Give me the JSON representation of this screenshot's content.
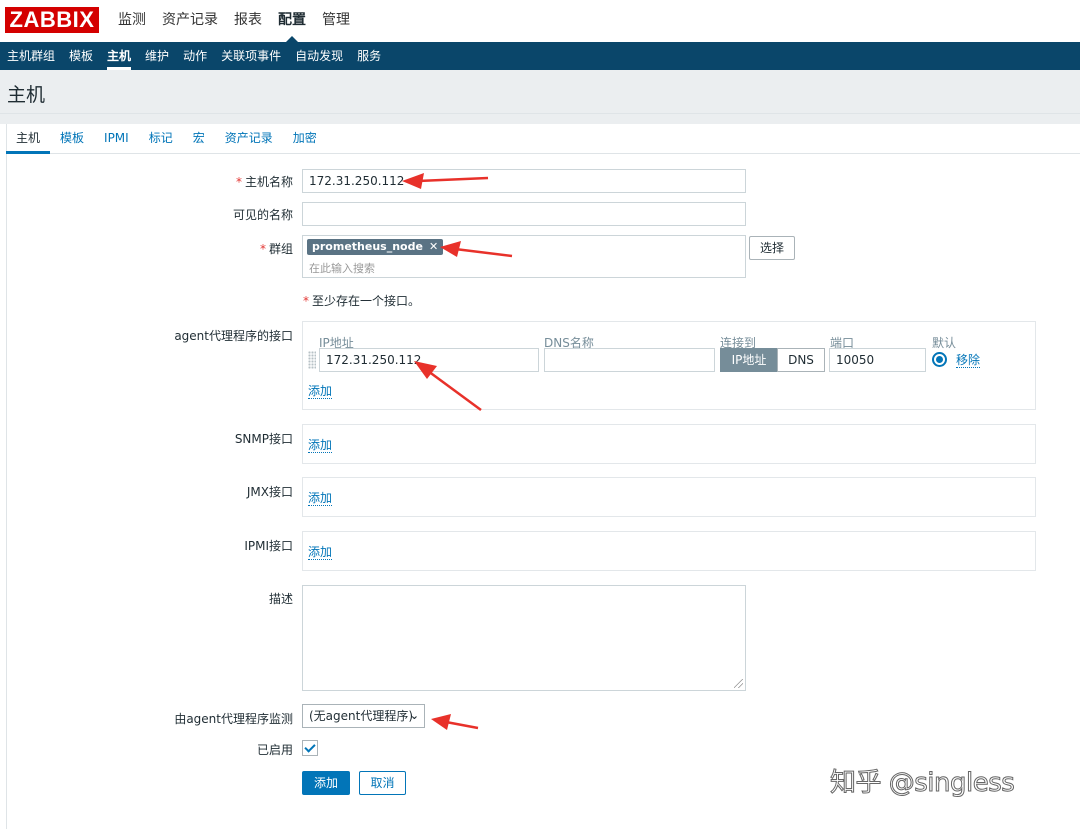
{
  "logo": "ZABBIX",
  "main_menu": [
    {
      "label": "监测"
    },
    {
      "label": "资产记录"
    },
    {
      "label": "报表"
    },
    {
      "label": "配置"
    },
    {
      "label": "管理"
    }
  ],
  "sub_menu": [
    {
      "label": "主机群组"
    },
    {
      "label": "模板"
    },
    {
      "label": "主机"
    },
    {
      "label": "维护"
    },
    {
      "label": "动作"
    },
    {
      "label": "关联项事件"
    },
    {
      "label": "自动发现"
    },
    {
      "label": "服务"
    }
  ],
  "page_title": "主机",
  "tabs": [
    {
      "label": "主机"
    },
    {
      "label": "模板"
    },
    {
      "label": "IPMI"
    },
    {
      "label": "标记"
    },
    {
      "label": "宏"
    },
    {
      "label": "资产记录"
    },
    {
      "label": "加密"
    }
  ],
  "form": {
    "hostname_label": "主机名称",
    "hostname_value": "172.31.250.112",
    "visible_name_label": "可见的名称",
    "visible_name_value": "",
    "groups_label": "群组",
    "group_tag": "prometheus_node",
    "group_tag_remove": "✕",
    "groups_search_placeholder": "在此输入搜索",
    "select_button": "选择",
    "required_mark": "*",
    "interface_note": "至少存在一个接口。",
    "agent_iface_label": "agent代理程序的接口",
    "iface_headers": {
      "ip": "IP地址",
      "dns": "DNS名称",
      "connect": "连接到",
      "port": "端口",
      "default": "默认"
    },
    "agent_iface": {
      "ip": "172.31.250.112",
      "dns": "",
      "connect_ip": "IP地址",
      "connect_dns": "DNS",
      "port": "10050",
      "remove": "移除"
    },
    "add_link": "添加",
    "snmp_label": "SNMP接口",
    "jmx_label": "JMX接口",
    "ipmi_label": "IPMI接口",
    "description_label": "描述",
    "description_value": "",
    "proxy_label": "由agent代理程序监测",
    "proxy_value": "(无agent代理程序)",
    "enabled_label": "已启用",
    "enabled": true,
    "submit_button": "添加",
    "cancel_button": "取消"
  },
  "watermark": "知乎 @singless",
  "colors": {
    "logo_bg": "#d40000",
    "nav_bg": "#0a466a",
    "link": "#0275b8",
    "required": "#e33734",
    "annotation_arrow": "#e8312a"
  }
}
